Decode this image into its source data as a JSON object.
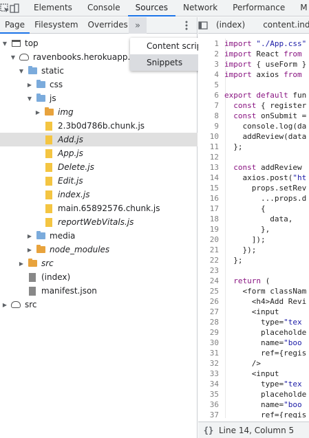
{
  "devtools": {
    "tabs": [
      {
        "label": "Elements"
      },
      {
        "label": "Console"
      },
      {
        "label": "Sources"
      },
      {
        "label": "Network"
      },
      {
        "label": "Performance"
      },
      {
        "label": "M"
      }
    ],
    "active_tab": "Sources"
  },
  "navigator": {
    "subtabs": [
      {
        "label": "Page"
      },
      {
        "label": "Filesystem"
      },
      {
        "label": "Overrides"
      }
    ],
    "more_label": "»",
    "menu": [
      {
        "label": "Content scripts"
      },
      {
        "label": "Snippets"
      }
    ],
    "tree": [
      {
        "label": "top",
        "depth": 0,
        "icon": "frame",
        "arrow": "down"
      },
      {
        "label": "ravenbooks.herokuapp.com",
        "depth": 1,
        "icon": "cloud",
        "arrow": "down"
      },
      {
        "label": "static",
        "depth": 2,
        "icon": "folder-blue",
        "arrow": "down"
      },
      {
        "label": "css",
        "depth": 3,
        "icon": "folder-blue",
        "arrow": "right"
      },
      {
        "label": "js",
        "depth": 3,
        "icon": "folder-blue",
        "arrow": "down"
      },
      {
        "label": "img",
        "depth": 4,
        "icon": "folder-orange",
        "arrow": "right",
        "italic": true
      },
      {
        "label": "2.3b0d786b.chunk.js",
        "depth": 4,
        "icon": "file-yellow"
      },
      {
        "label": "Add.js",
        "depth": 4,
        "icon": "file-yellow",
        "italic": true,
        "selected": true
      },
      {
        "label": "App.js",
        "depth": 4,
        "icon": "file-yellow",
        "italic": true
      },
      {
        "label": "Delete.js",
        "depth": 4,
        "icon": "file-yellow",
        "italic": true
      },
      {
        "label": "Edit.js",
        "depth": 4,
        "icon": "file-yellow",
        "italic": true
      },
      {
        "label": "index.js",
        "depth": 4,
        "icon": "file-yellow",
        "italic": true
      },
      {
        "label": "main.65892576.chunk.js",
        "depth": 4,
        "icon": "file-yellow"
      },
      {
        "label": "reportWebVitals.js",
        "depth": 4,
        "icon": "file-yellow",
        "italic": true
      },
      {
        "label": "media",
        "depth": 3,
        "icon": "folder-blue",
        "arrow": "right"
      },
      {
        "label": "node_modules",
        "depth": 3,
        "icon": "folder-orange",
        "arrow": "right",
        "italic": true
      },
      {
        "label": "src",
        "depth": 2,
        "icon": "folder-orange",
        "arrow": "right",
        "italic": true
      },
      {
        "label": "(index)",
        "depth": 2,
        "icon": "file-gray"
      },
      {
        "label": "manifest.json",
        "depth": 2,
        "icon": "file-gray"
      },
      {
        "label": "src",
        "depth": 0,
        "icon": "cloud",
        "arrow": "right"
      }
    ]
  },
  "editor": {
    "tabs": [
      {
        "label": "(index)"
      },
      {
        "label": "content.inde"
      }
    ],
    "lines": [
      {
        "n": "1",
        "text": "import \"./App.css\""
      },
      {
        "n": "2",
        "text": "import React from"
      },
      {
        "n": "3",
        "text": "import { useForm }"
      },
      {
        "n": "4",
        "text": "import axios from"
      },
      {
        "n": "5",
        "text": ""
      },
      {
        "n": "6",
        "text": "export default fun"
      },
      {
        "n": "7",
        "text": "  const { register"
      },
      {
        "n": "8",
        "text": "  const onSubmit ="
      },
      {
        "n": "9",
        "text": "    console.log(da"
      },
      {
        "n": "10",
        "text": "    addReview(data"
      },
      {
        "n": "11",
        "text": "  };"
      },
      {
        "n": "12",
        "text": ""
      },
      {
        "n": "13",
        "text": "  const addReview"
      },
      {
        "n": "14",
        "text": "    axios.post(\"ht"
      },
      {
        "n": "15",
        "text": "      props.setRev"
      },
      {
        "n": "16",
        "text": "        ...props.d"
      },
      {
        "n": "17",
        "text": "        {"
      },
      {
        "n": "18",
        "text": "          data,"
      },
      {
        "n": "19",
        "text": "        },"
      },
      {
        "n": "20",
        "text": "      ]);"
      },
      {
        "n": "21",
        "text": "    });"
      },
      {
        "n": "22",
        "text": "  };"
      },
      {
        "n": "23",
        "text": ""
      },
      {
        "n": "24",
        "text": "  return ("
      },
      {
        "n": "25",
        "text": "    <form classNam"
      },
      {
        "n": "26",
        "text": "      <h4>Add Revi"
      },
      {
        "n": "27",
        "text": "      <input"
      },
      {
        "n": "28",
        "text": "        type=\"tex"
      },
      {
        "n": "29",
        "text": "        placeholde"
      },
      {
        "n": "30",
        "text": "        name=\"boo"
      },
      {
        "n": "31",
        "text": "        ref={regis"
      },
      {
        "n": "32",
        "text": "      />"
      },
      {
        "n": "33",
        "text": "      <input"
      },
      {
        "n": "34",
        "text": "        type=\"tex"
      },
      {
        "n": "35",
        "text": "        placeholde"
      },
      {
        "n": "36",
        "text": "        name=\"boo"
      },
      {
        "n": "37",
        "text": "        ref={regis"
      },
      {
        "n": "38",
        "text": "      />"
      },
      {
        "n": "39",
        "text": "      <input"
      },
      {
        "n": "40",
        "text": "        type=\"numb"
      }
    ],
    "status": {
      "brackets": "{}",
      "position": "Line 14, Column 5"
    }
  }
}
